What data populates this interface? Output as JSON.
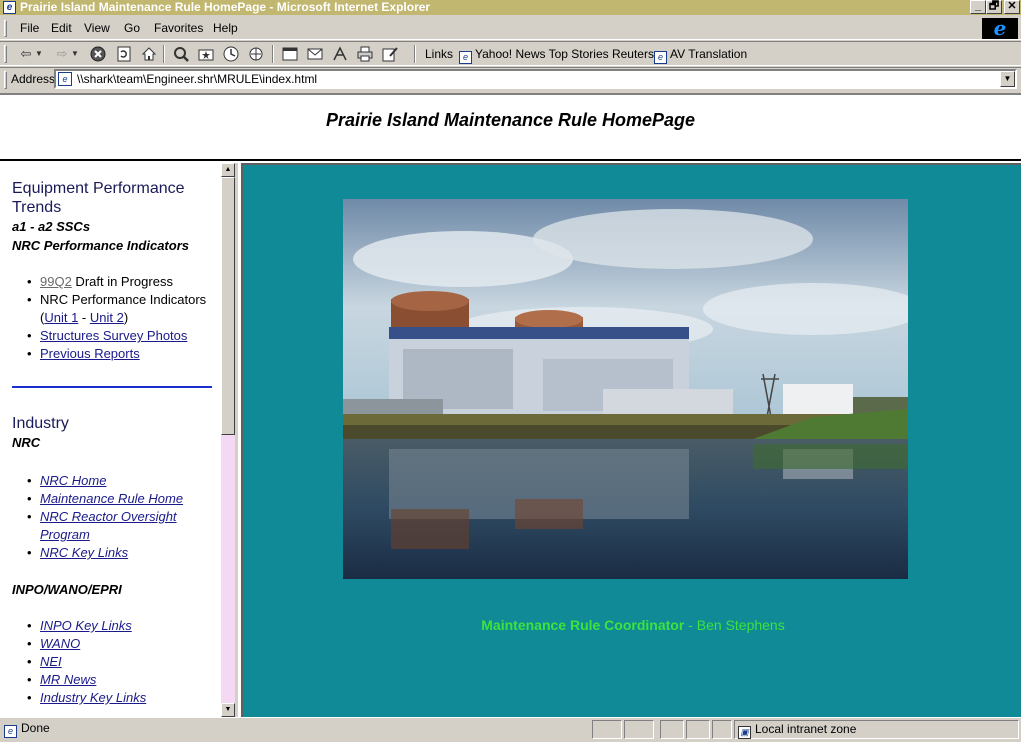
{
  "window": {
    "title": "Prairie Island Maintenance Rule HomePage - Microsoft Internet Explorer",
    "minimize": "_",
    "restore": "🗗",
    "close": "✕"
  },
  "menu": [
    "File",
    "Edit",
    "View",
    "Go",
    "Favorites",
    "Help"
  ],
  "toolbar": {
    "links_label": "Links",
    "links": [
      "Yahoo! News Top Stories Reuters",
      "AV Translation"
    ]
  },
  "address": {
    "label": "Address",
    "url": "\\\\shark\\team\\Engineer.shr\\MRULE\\index.html"
  },
  "page": {
    "heading": "Prairie Island Maintenance Rule HomePage"
  },
  "nav": {
    "equipment_title": "Equipment Performance Trends",
    "ssc_label": "a1 - a2 SSCs",
    "nrc_pi_label": "NRC Performance Indicators",
    "items": {
      "draft_link": "99Q2",
      "draft_text": " Draft in Progress",
      "pi_text_a": "NRC Performance Indicators (",
      "unit1": "Unit 1",
      "pi_sep": " - ",
      "unit2": "Unit 2",
      "pi_text_b": ")",
      "survey": "Structures Survey Photos",
      "previous": "Previous Reports"
    },
    "industry_title": "Industry",
    "nrc_label": "NRC",
    "nrc_links": [
      "NRC Home",
      "Maintenance Rule Home",
      "NRC Reactor Oversight Program",
      "NRC Key Links"
    ],
    "inpo_label": "INPO/WANO/EPRI",
    "inpo_links": [
      "INPO Key Links",
      "WANO",
      "NEI",
      "MR News",
      "Industry Key Links"
    ]
  },
  "main": {
    "coordinator_role": "Maintenance Rule Coordinator",
    "coordinator_sep": " - ",
    "coordinator_name": "Ben Stephens"
  },
  "status": {
    "text": "Done",
    "zone": "Local intranet zone"
  }
}
